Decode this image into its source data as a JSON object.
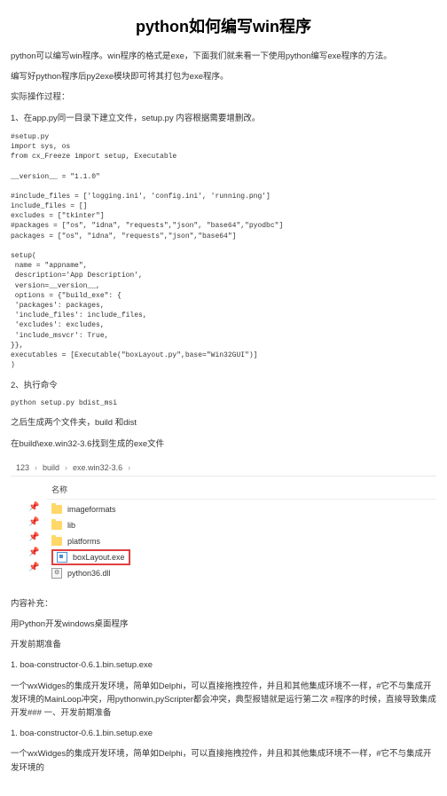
{
  "title": "python如何编写win程序",
  "intro1": "python可以编写win程序。win程序的格式是exe，下面我们就来看一下使用python编写exe程序的方法。",
  "intro2": "编写好python程序后py2exe模块即可将其打包为exe程序。",
  "intro3": "实际操作过程：",
  "step1": "1、在app.py同一目录下建立文件，setup.py 内容根据需要增删改。",
  "code1": "#setup.py\nimport sys, os\nfrom cx_Freeze import setup, Executable\n\n__version__ = \"1.1.0\"\n\n#include_files = ['logging.ini', 'config.ini', 'running.png']\ninclude_files = []\nexcludes = [\"tkinter\"]\n#packages = [\"os\", \"idna\", \"requests\",\"json\", \"base64\",\"pyodbc\"]\npackages = [\"os\", \"idna\", \"requests\",\"json\",\"base64\"]\n\nsetup(\n name = \"appname\",\n description='App Description',\n version=__version__,\n options = {\"build_exe\": {\n 'packages': packages,\n 'include_files': include_files,\n 'excludes': excludes,\n 'include_msvcr': True,\n}},\nexecutables = [Executable(\"boxLayout.py\",base=\"Win32GUI\")]\n)",
  "step2": "2、执行命令",
  "cmd": "python setup.py bdist_msi",
  "step3a": "之后生成两个文件夹，build 和dist",
  "step3b": "在build\\exe.win32-3.6找到生成的exe文件",
  "breadcrumb": {
    "p1": "123",
    "p2": "build",
    "p3": "exe.win32-3.6"
  },
  "col_name": "名称",
  "files": {
    "f1": "imageformats",
    "f2": "lib",
    "f3": "platforms",
    "f4": "boxLayout.exe",
    "f5": "python36.dll"
  },
  "supp_head": "内容补充：",
  "supp1": "用Python开发windows桌面程序",
  "supp2": "开发前期准备",
  "supp3": "1. boa-constructor-0.6.1.bin.setup.exe",
  "supp4": "一个wxWidges的集成开发环境，简单如Delphi，可以直接拖拽控件，并且和其他集成环境不一样，#它不与集成开发环境的MainLoop冲突，用pythonwin,pyScripter都会冲突，典型报错就是运行第二次 #程序的时候，直接导致集成开发### 一、开发前期准备",
  "supp5": "1. boa-constructor-0.6.1.bin.setup.exe",
  "supp6": "一个wxWidges的集成开发环境，简单如Delphi，可以直接拖拽控件，并且和其他集成环境不一样，#它不与集成开发环境的"
}
